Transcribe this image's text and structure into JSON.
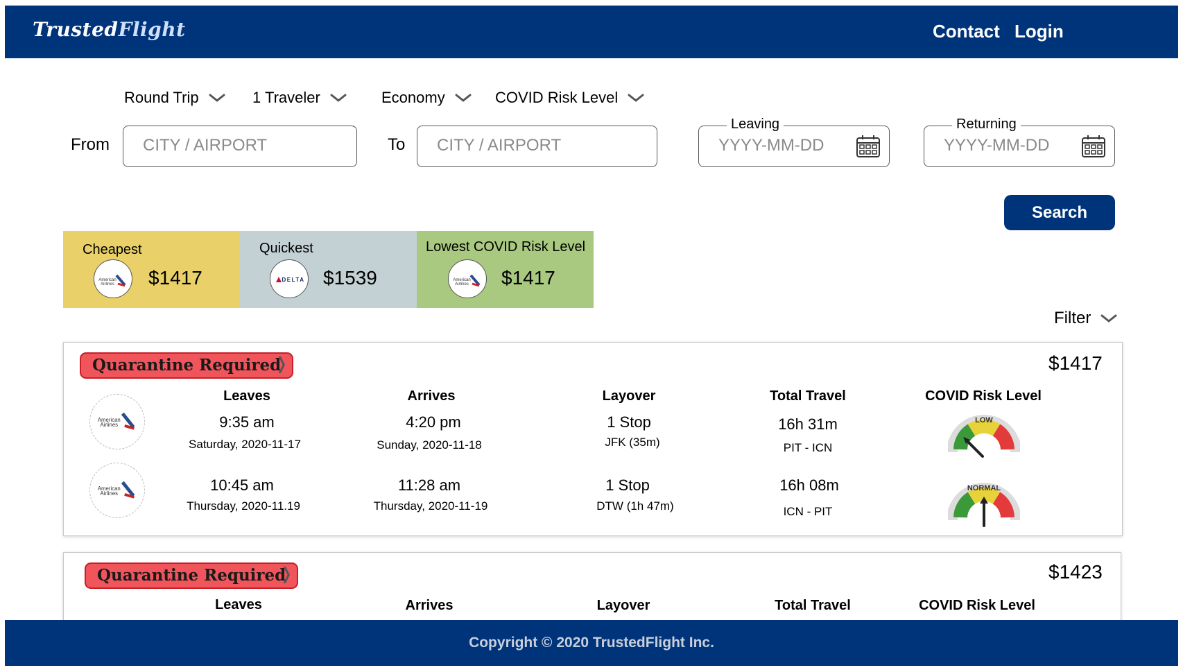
{
  "header": {
    "brand_part1": "Trusted",
    "brand_part2": "Flight",
    "contact_label": "Contact",
    "login_label": "Login"
  },
  "search": {
    "trip_type": "Round Trip",
    "travelers": "1 Traveler",
    "cabin": "Economy",
    "covid_risk_filter": "COVID Risk Level",
    "from_label": "From",
    "from_placeholder": "CITY / AIRPORT",
    "to_label": "To",
    "to_placeholder": "CITY / AIRPORT",
    "leaving_label": "Leaving",
    "leaving_placeholder": "YYYY-MM-DD",
    "returning_label": "Returning",
    "returning_placeholder": "YYYY-MM-DD",
    "search_label": "Search"
  },
  "summary": [
    {
      "title": "Cheapest",
      "airline": "American Airlines",
      "price": "$1417",
      "color": "#e9d068"
    },
    {
      "title": "Quickest",
      "airline": "Delta",
      "price": "$1539",
      "color": "#c3d1d4"
    },
    {
      "title": "Lowest COVID Risk Level",
      "airline": "American Airlines",
      "price": "$1417",
      "color": "#a9c980"
    }
  ],
  "filter_label": "Filter",
  "columns": {
    "leaves": "Leaves",
    "arrives": "Arrives",
    "layover": "Layover",
    "total_travel": "Total Travel",
    "covid_risk": "COVID Risk Level"
  },
  "results": [
    {
      "badge": "Quarantine Required",
      "price": "$1417",
      "legs": [
        {
          "airline": "American Airlines",
          "leave_time": "9:35 am",
          "leave_date": "Saturday, 2020-11-17",
          "arrive_time": "4:20 pm",
          "arrive_date": "Sunday, 2020-11-18",
          "stops": "1 Stop",
          "layover": "JFK (35m)",
          "duration": "16h 31m",
          "route": "PIT - ICN",
          "risk_label": "LOW"
        },
        {
          "airline": "American Airlines",
          "leave_time": "10:45 am",
          "leave_date": "Thursday, 2020-11.19",
          "arrive_time": "11:28 am",
          "arrive_date": "Thursday, 2020-11-19",
          "stops": "1 Stop",
          "layover": "DTW (1h 47m)",
          "duration": "16h 08m",
          "route": "ICN - PIT",
          "risk_label": "NORMAL"
        }
      ]
    },
    {
      "badge": "Quarantine Required",
      "price": "$1423"
    }
  ],
  "colors": {
    "brand": "#00347a",
    "quarantine_fill": "#f0555c",
    "quarantine_border": "#c81e25",
    "gauge_green": "#3a9a3a",
    "gauge_yellow": "#e8d23a",
    "gauge_red": "#e33b3b"
  },
  "footer": {
    "copyright": "Copyright © 2020 TrustedFlight Inc."
  }
}
